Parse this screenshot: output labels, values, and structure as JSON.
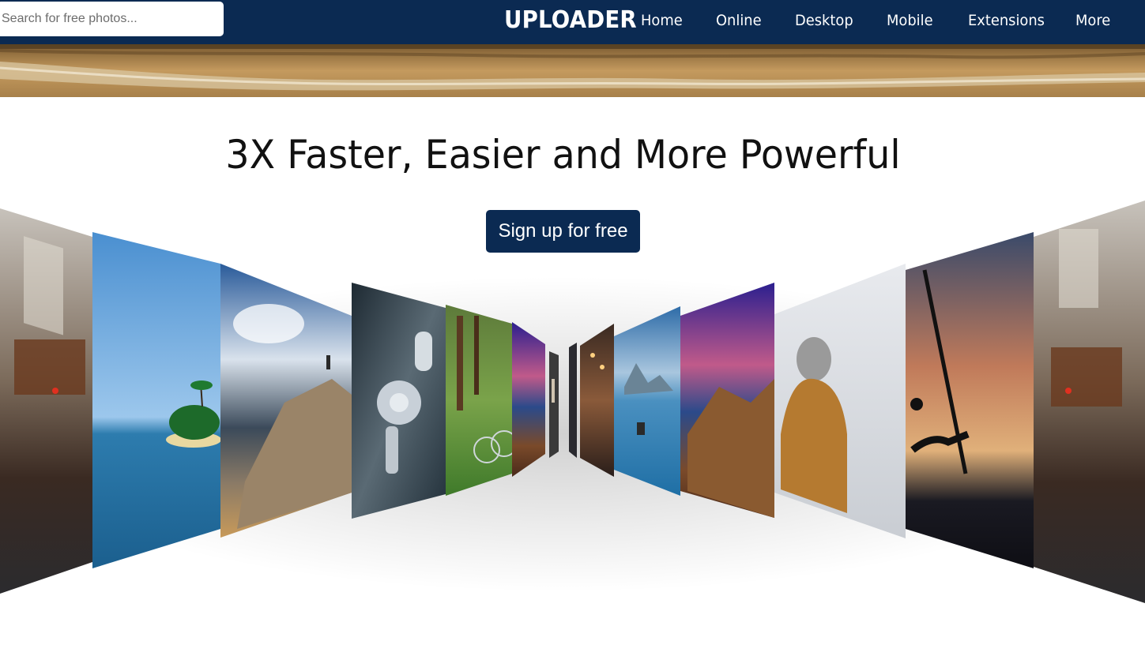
{
  "search": {
    "placeholder": "Search for free photos..."
  },
  "header": {
    "brand": "UPLOADER",
    "nav": [
      "Home",
      "Online",
      "Desktop",
      "Mobile",
      "Extensions",
      "More"
    ]
  },
  "hero": {
    "headline": "3X Faster, Easier and More Powerful",
    "signup_label": "Sign up for free"
  },
  "colors": {
    "brand_navy": "#0b2a52",
    "background": "#ffffff"
  },
  "gallery": {
    "images": [
      "city-street-photo",
      "tropical-island-photo",
      "hiker-on-rock-photo",
      "robot-photo",
      "bicycle-in-park-photo",
      "mountain-sunset-photo",
      "small-center-photo-left",
      "small-center-photo-right",
      "night-street-photo",
      "kayak-lake-photo",
      "mountain-sunset-photo-2",
      "person-in-hood-photo",
      "dancer-silhouette-photo",
      "city-street-photo-2"
    ]
  }
}
